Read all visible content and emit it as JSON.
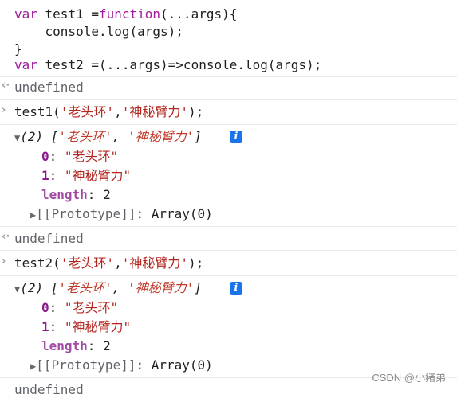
{
  "code_block": {
    "line1": {
      "kw": "var",
      "rest1": " test1 =",
      "kw2": "function",
      "rest2": "(...args){"
    },
    "line2": "    console.log(args);",
    "line3": "}",
    "line4": {
      "kw": "var",
      "rest": " test2 =(...args)=>console.log(args);"
    }
  },
  "results": {
    "undefined_1": "undefined",
    "undefined_2": "undefined",
    "undefined_3": "undefined"
  },
  "call1": {
    "prefix": "test1(",
    "arg1": "'老头环'",
    "comma": ",",
    "arg2": "'神秘臂力'",
    "suffix": ");"
  },
  "call2": {
    "prefix": "test2(",
    "arg1": "'老头环'",
    "comma": ",",
    "arg2": "'神秘臂力'",
    "suffix": ");"
  },
  "array1": {
    "summary_count": "(2) ",
    "summary_open": "[",
    "item0_preview": "'老头环'",
    "sep": ", ",
    "item1_preview": "'神秘臂力'",
    "summary_close": "]",
    "entries": [
      {
        "key": "0",
        "colon": ": ",
        "value": "\"老头环\""
      },
      {
        "key": "1",
        "colon": ": ",
        "value": "\"神秘臂力\""
      }
    ],
    "length_key": "length",
    "length_colon": ": ",
    "length_value": "2",
    "prototype_label": "[[Prototype]]",
    "prototype_value": ": Array(0)"
  },
  "array2": {
    "summary_count": "(2) ",
    "summary_open": "[",
    "item0_preview": "'老头环'",
    "sep": ", ",
    "item1_preview": "'神秘臂力'",
    "summary_close": "]",
    "entries": [
      {
        "key": "0",
        "colon": ": ",
        "value": "\"老头环\""
      },
      {
        "key": "1",
        "colon": ": ",
        "value": "\"神秘臂力\""
      }
    ],
    "length_key": "length",
    "length_colon": ": ",
    "length_value": "2",
    "prototype_label": "[[Prototype]]",
    "prototype_value": ": Array(0)"
  },
  "info_icon_glyph": "i",
  "watermark": "CSDN @小猪弟",
  "colors": {
    "keyword": "#a31b9c",
    "string": "#b3261e",
    "info": "#1a73e8",
    "divider": "#e8eaed"
  },
  "icons": [
    "input-chevron-icon",
    "result-chevron-icon",
    "expand-caret-icon",
    "info-icon"
  ]
}
